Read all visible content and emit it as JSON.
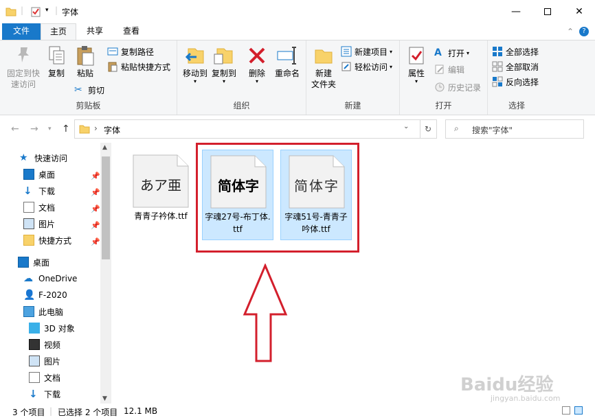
{
  "window": {
    "title": "字体",
    "controls": [
      "minimize-icon",
      "maximize-icon",
      "close-icon"
    ]
  },
  "tabs": [
    {
      "label": "文件"
    },
    {
      "label": "主页"
    },
    {
      "label": "共享"
    },
    {
      "label": "查看"
    }
  ],
  "ribbon": {
    "clipboard": {
      "group_label": "剪贴板",
      "pin_quick_access": "固定到快速访问",
      "pin_line1": "固定到快",
      "pin_line2": "速访问",
      "copy": "复制",
      "paste": "粘贴",
      "copy_path": "复制路径",
      "paste_shortcut": "粘贴快捷方式",
      "cut": "剪切"
    },
    "organize": {
      "group_label": "组织",
      "move_to": "移动到",
      "copy_to": "复制到",
      "delete": "删除",
      "rename": "重命名"
    },
    "new": {
      "group_label": "新建",
      "new_folder_line1": "新建",
      "new_folder_line2": "文件夹",
      "new_item": "新建项目",
      "easy_access": "轻松访问"
    },
    "open": {
      "group_label": "打开",
      "properties": "属性",
      "open": "打开",
      "edit": "编辑",
      "history": "历史记录"
    },
    "select": {
      "group_label": "选择",
      "select_all": "全部选择",
      "select_none": "全部取消",
      "invert": "反向选择"
    }
  },
  "address": {
    "path": "字体",
    "search_placeholder": "搜索\"字体\""
  },
  "nav": {
    "quick_access": "快速访问",
    "items": [
      {
        "label": "桌面",
        "pinned": true
      },
      {
        "label": "下载",
        "pinned": true
      },
      {
        "label": "文档",
        "pinned": true
      },
      {
        "label": "图片",
        "pinned": true
      },
      {
        "label": "快捷方式",
        "pinned": true
      }
    ],
    "desktop": "桌面",
    "onedrive": "OneDrive",
    "user": "F-2020",
    "this_pc": "此电脑",
    "pc_items": [
      {
        "label": "3D 对象"
      },
      {
        "label": "视频"
      },
      {
        "label": "图片"
      },
      {
        "label": "文档"
      },
      {
        "label": "下载"
      }
    ]
  },
  "files": [
    {
      "preview": "あア亜",
      "name": "青青子衿体.ttf",
      "selected": false
    },
    {
      "preview": "简体字",
      "name": "字魂27号-布丁体.ttf",
      "selected": true
    },
    {
      "preview": "简体字",
      "name": "字魂51号-青青子吟体.ttf",
      "selected": true
    }
  ],
  "status": {
    "count": "3 个项目",
    "selected": "已选择 2 个项目",
    "size": "12.1 MB"
  },
  "watermark": {
    "brand": "Baidu经验",
    "url": "jingyan.baidu.com"
  },
  "colors": {
    "accent": "#1979ca",
    "selection": "#cce8ff",
    "highlight_border": "#d31f2c"
  }
}
